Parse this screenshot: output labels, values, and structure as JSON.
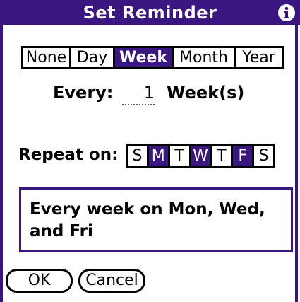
{
  "dialog": {
    "title": "Set Reminder",
    "info_icon": "info-icon"
  },
  "frequency": {
    "options": [
      "None",
      "Day",
      "Week",
      "Month",
      "Year"
    ],
    "selected": "Week"
  },
  "every": {
    "label": "Every:",
    "value": "1",
    "unit": "Week(s)"
  },
  "repeat": {
    "label": "Repeat on:",
    "days": [
      "S",
      "M",
      "T",
      "W",
      "T",
      "F",
      "S"
    ],
    "selected_days": [
      "M",
      "W",
      "F"
    ]
  },
  "summary": {
    "text": "Every week on Mon, Wed, and Fri"
  },
  "buttons": {
    "ok": "OK",
    "cancel": "Cancel"
  },
  "colors": {
    "accent": "#3a1780",
    "background": "#ffffff"
  }
}
